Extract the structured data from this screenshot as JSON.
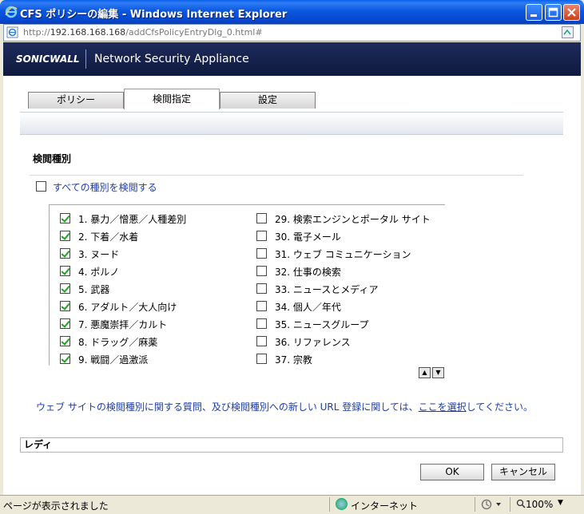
{
  "window": {
    "title": "CFS ポリシーの編集 - Windows Internet Explorer",
    "min_icon": "minimize-icon",
    "max_icon": "maximize-icon",
    "close_icon": "close-icon"
  },
  "address_bar": {
    "scheme": "http://",
    "host": "192.168.168.168",
    "path": "/addCfsPolicyEntryDlg_0.html#"
  },
  "app_header": {
    "brand": "SONICWALL",
    "title": "Network Security Appliance"
  },
  "tabs": [
    {
      "label": "ポリシー",
      "active": false
    },
    {
      "label": "検閲指定",
      "active": true
    },
    {
      "label": "設定",
      "active": false
    }
  ],
  "section": {
    "title": "検閲種別",
    "select_all_label": "すべての種別を検閲する",
    "select_all_checked": false
  },
  "categories_left": [
    {
      "label": "1. 暴力／憎悪／人種差別",
      "checked": true
    },
    {
      "label": "2. 下着／水着",
      "checked": true
    },
    {
      "label": "3. ヌード",
      "checked": true
    },
    {
      "label": "4. ポルノ",
      "checked": true
    },
    {
      "label": "5. 武器",
      "checked": true
    },
    {
      "label": "6. アダルト／大人向け",
      "checked": true
    },
    {
      "label": "7. 悪魔崇拝／カルト",
      "checked": true
    },
    {
      "label": "8. ドラッグ／麻薬",
      "checked": true
    },
    {
      "label": "9. 戦闘／過激派",
      "checked": true
    }
  ],
  "categories_right": [
    {
      "label": "29. 検索エンジンとポータル サイト",
      "checked": false
    },
    {
      "label": "30. 電子メール",
      "checked": false
    },
    {
      "label": "31. ウェブ コミュニケーション",
      "checked": false
    },
    {
      "label": "32. 仕事の検索",
      "checked": false
    },
    {
      "label": "33. ニュースとメディア",
      "checked": false
    },
    {
      "label": "34. 個人／年代",
      "checked": false
    },
    {
      "label": "35. ニュースグループ",
      "checked": false
    },
    {
      "label": "36. リファレンス",
      "checked": false
    },
    {
      "label": "37. 宗教",
      "checked": false
    }
  ],
  "scroll": {
    "up_glyph": "▲",
    "down_glyph": "▼"
  },
  "info": {
    "before": "ウェブ サイトの検閲種別に関する質問、及び検閲種別への新しい URL 登録に関しては、",
    "link": "ここを選択",
    "after": "してください。"
  },
  "status_field": {
    "value": "レディ"
  },
  "buttons": {
    "ok": "OK",
    "cancel": "キャンセル"
  },
  "statusbar": {
    "text": "ページが表示されました",
    "zone": "インターネット",
    "zoom": "100%",
    "zoom_arrow": "▼"
  },
  "colors": {
    "titlebar": "#0B58E0",
    "header_bg": "#1D2B5C",
    "link": "#1D3EA7",
    "check": "#21A121"
  }
}
